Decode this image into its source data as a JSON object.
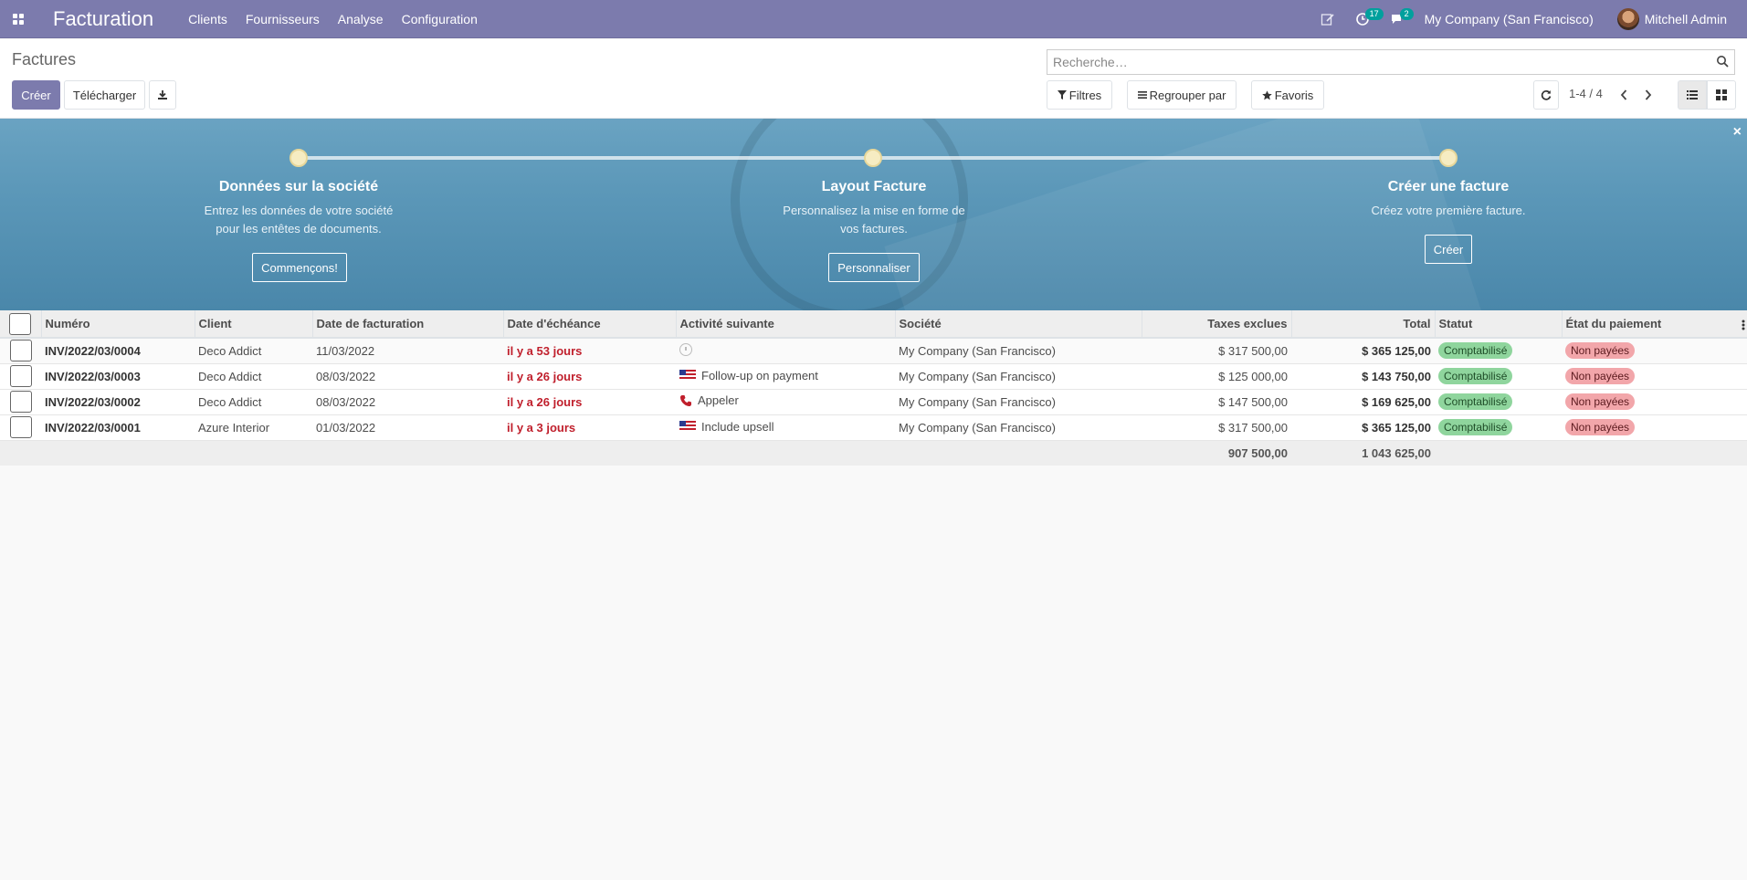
{
  "navbar": {
    "app_title": "Facturation",
    "menu": [
      "Clients",
      "Fournisseurs",
      "Analyse",
      "Configuration"
    ],
    "activity_count": "17",
    "messages_count": "2",
    "company": "My Company (San Francisco)",
    "user": "Mitchell Admin"
  },
  "control": {
    "title": "Factures",
    "create_label": "Créer",
    "upload_label": "Télécharger",
    "search_placeholder": "Recherche…",
    "filters_label": "Filtres",
    "groupby_label": "Regrouper par",
    "favorites_label": "Favoris",
    "pager": "1-4 / 4"
  },
  "banner": {
    "steps": [
      {
        "title": "Données sur la société",
        "line1": "Entrez les données de votre société",
        "line2": "pour les entêtes de documents.",
        "button": "Commençons!"
      },
      {
        "title": "Layout Facture",
        "line1": "Personnalisez la mise en forme de",
        "line2": "vos factures.",
        "button": "Personnaliser"
      },
      {
        "title": "Créer une facture",
        "line1": "Créez votre première facture.",
        "line2": "",
        "button": "Créer"
      }
    ]
  },
  "table": {
    "headers": [
      "Numéro",
      "Client",
      "Date de facturation",
      "Date d'échéance",
      "Activité suivante",
      "Société",
      "Taxes exclues",
      "Total",
      "Statut",
      "État du paiement"
    ],
    "rows": [
      {
        "number": "INV/2022/03/0004",
        "client": "Deco Addict",
        "date": "11/03/2022",
        "due": "il y a 53 jours",
        "activity": "",
        "activity_icon": "clock-icon",
        "company": "My Company (San Francisco)",
        "untaxed": "$ 317 500,00",
        "total": "$ 365 125,00",
        "status": "Comptabilisé",
        "payment": "Non payées"
      },
      {
        "number": "INV/2022/03/0003",
        "client": "Deco Addict",
        "date": "08/03/2022",
        "due": "il y a 26 jours",
        "activity": "Follow-up on payment",
        "activity_icon": "flag-icon",
        "company": "My Company (San Francisco)",
        "untaxed": "$ 125 000,00",
        "total": "$ 143 750,00",
        "status": "Comptabilisé",
        "payment": "Non payées"
      },
      {
        "number": "INV/2022/03/0002",
        "client": "Deco Addict",
        "date": "08/03/2022",
        "due": "il y a 26 jours",
        "activity": "Appeler",
        "activity_icon": "phone-icon",
        "company": "My Company (San Francisco)",
        "untaxed": "$ 147 500,00",
        "total": "$ 169 625,00",
        "status": "Comptabilisé",
        "payment": "Non payées"
      },
      {
        "number": "INV/2022/03/0001",
        "client": "Azure Interior",
        "date": "01/03/2022",
        "due": "il y a 3 jours",
        "activity": "Include upsell",
        "activity_icon": "flag-icon",
        "company": "My Company (San Francisco)",
        "untaxed": "$ 317 500,00",
        "total": "$ 365 125,00",
        "status": "Comptabilisé",
        "payment": "Non payées"
      }
    ],
    "footer_untaxed": "907 500,00",
    "footer_total": "1 043 625,00"
  },
  "colors": {
    "brand": "#7c7bad",
    "overdue": "#c01f2c",
    "posted": "#8fd59d",
    "unpaid": "#f2a6aa"
  }
}
